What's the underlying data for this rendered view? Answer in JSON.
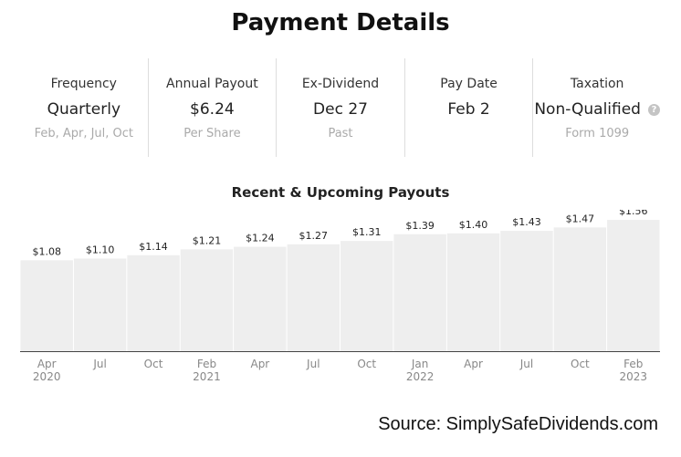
{
  "page": {
    "title": "Payment Details"
  },
  "stats": [
    {
      "label": "Frequency",
      "value": "Quarterly",
      "sub": "Feb, Apr, Jul, Oct"
    },
    {
      "label": "Annual Payout",
      "value": "$6.24",
      "sub": "Per Share"
    },
    {
      "label": "Ex-Dividend",
      "value": "Dec 27",
      "sub": "Past"
    },
    {
      "label": "Pay Date",
      "value": "Feb 2",
      "sub": ""
    },
    {
      "label": "Taxation",
      "value": "Non-Qualified",
      "sub": "Form 1099",
      "icon": "question-circle-icon"
    }
  ],
  "colors": {
    "bar": "#eeeeee",
    "axis": "#444444",
    "tick_label": "#888888",
    "value_label": "#222222"
  },
  "chart_data": {
    "type": "bar",
    "title": "Recent & Upcoming Payouts",
    "categories": [
      "Apr 2020",
      "Jul",
      "Oct",
      "Feb 2021",
      "Apr",
      "Jul",
      "Oct",
      "Jan 2022",
      "Apr",
      "Jul",
      "Oct",
      "Feb 2023"
    ],
    "tick_labels": [
      [
        "Apr",
        "2020"
      ],
      [
        "Jul"
      ],
      [
        "Oct"
      ],
      [
        "Feb",
        "2021"
      ],
      [
        "Apr"
      ],
      [
        "Jul"
      ],
      [
        "Oct"
      ],
      [
        "Jan",
        "2022"
      ],
      [
        "Apr"
      ],
      [
        "Jul"
      ],
      [
        "Oct"
      ],
      [
        "Feb",
        "2023"
      ]
    ],
    "values": [
      1.08,
      1.1,
      1.14,
      1.21,
      1.24,
      1.27,
      1.31,
      1.39,
      1.4,
      1.43,
      1.47,
      1.56
    ],
    "value_labels": [
      "$1.08",
      "$1.10",
      "$1.14",
      "$1.21",
      "$1.24",
      "$1.27",
      "$1.31",
      "$1.39",
      "$1.40",
      "$1.43",
      "$1.47",
      "$1.56"
    ],
    "ylim": [
      0,
      1.68
    ],
    "grid": false
  },
  "footer": {
    "source": "Source: SimplySafeDividends.com"
  }
}
